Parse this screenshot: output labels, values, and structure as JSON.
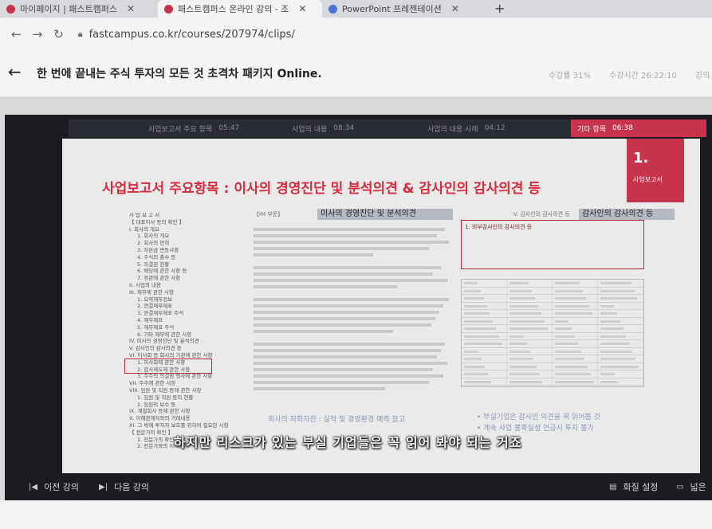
{
  "browser": {
    "tabs": [
      {
        "label": "마이페이지 | 패스트캠퍼스",
        "favicon_color": "#c9344d",
        "active": false
      },
      {
        "label": "패스트캠퍼스 온라인 강의 - 조",
        "favicon_color": "#c9344d",
        "active": true
      },
      {
        "label": "PowerPoint 프레젠테이션",
        "favicon_color": "#4a74d8",
        "active": false
      }
    ],
    "new_tab_label": "+",
    "url": "fastcampus.co.kr/courses/207974/clips/"
  },
  "header": {
    "title": "한 번에 끝내는 주식 투자의 모든 것 초격차 패키지 Online.",
    "progress_label": "수강률 31%",
    "time_label": "수강시간 26:22:10",
    "trailing_label": "강의"
  },
  "player": {
    "logo": "fastcampus",
    "segments": [
      {
        "label": "사업보고서 주요 항목",
        "time": "05:47"
      },
      {
        "label": "사업의 내용",
        "time": "08:34"
      },
      {
        "label": "사업의 내용 사례",
        "time": "04:12"
      },
      {
        "label": "기타 항목",
        "time": "06:38"
      }
    ],
    "slide": {
      "badge_number": "1.",
      "badge_label": "사업보고서",
      "title": "사업보고서 주요항목 : 이사의 경영진단 및 분석의견 & 감사인의 감사의견 등",
      "mid_heading": "이사의 경영진단 및 분석의견",
      "mid_small": "【IM 부문】",
      "right_heading_small": "V. 감사인의 감사의견 등",
      "right_heading": "감사인의 감사의견 등",
      "opinion_title": "1. 외부감사인의 감사의견 등",
      "toc": [
        "사 업 보 고 서",
        "【 대표이사 등의 확인 】",
        "I. 회사의 개요",
        "1. 회사의 개요",
        "2. 회사의 연혁",
        "3. 자본금 변동사항",
        "4. 주식의 총수 등",
        "5. 의결권 현황",
        "6. 배당에 관한 사항 등",
        "7. 정관에 관한 사항",
        "II. 사업의 내용",
        "III. 재무에 관한 사항",
        "1. 요약재무정보",
        "2. 연결재무제표",
        "3. 연결재무제표 주석",
        "4. 재무제표",
        "5. 재무제표 주석",
        "6. 기타 재무에 관한 사항",
        "IV. 이사의 경영진단 및 분석의견",
        "V. 감사인의 감사의견 등",
        "VI. 이사회 등 회사의 기관에 관한 사항",
        "1. 이사회에 관한 사항",
        "2. 감사제도에 관한 사항",
        "3. 주주의 의결권 행사에 관한 사항",
        "VII. 주주에 관한 사항",
        "VIII. 임원 및 직원 등에 관한 사항",
        "1. 임원 및 직원 등의 현황",
        "2. 임원의 보수 등",
        "IX. 계열회사 등에 관한 사항",
        "X. 이해관계자와의 거래내용",
        "XI. 그 밖에 투자자 보호를 위하여 필요한 사항",
        "【 전문가의 확인 】",
        "1. 전문가의 확인",
        "2. 전문가와의 이해관계"
      ],
      "note_left": "회사의 자화자찬 : 실적 및 경영환경 예측 참고",
      "note_right_1": "• 부실기업은 감사인 의견을 꼭 읽어볼 것",
      "note_right_2": "• 계속 사업 불확실성 언급시 투자 불가"
    },
    "subtitle": "하지만 리스크가 있는 부실 기업들은 꼭 읽어 봐야 되는 거죠"
  },
  "controls": {
    "prev_label": "이전 강의",
    "next_label": "다음 강의",
    "quality_label": "화질 설정",
    "wide_label": "넓은"
  },
  "colors": {
    "accent": "#c9344d",
    "title_red": "#d62b3f"
  }
}
